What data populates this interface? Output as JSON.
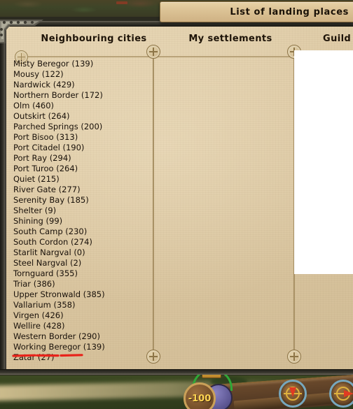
{
  "window": {
    "title": "List of landing places"
  },
  "columns": [
    {
      "id": "neighbouring-cities",
      "label": "Neighbouring cities"
    },
    {
      "id": "my-settlements",
      "label": "My settlements"
    },
    {
      "id": "guild-settlements",
      "label": "Guild s"
    }
  ],
  "cities": [
    {
      "name": "Misty Beregor",
      "value": "(139)",
      "label": "Misty Beregor (139)"
    },
    {
      "name": "Mousy",
      "value": "(122)",
      "label": "Mousy (122)"
    },
    {
      "name": "Nardwick",
      "value": "(429)",
      "label": "Nardwick (429)"
    },
    {
      "name": "Northern Border",
      "value": "(172)",
      "label": "Northern Border (172)"
    },
    {
      "name": "Olm",
      "value": "(460)",
      "label": "Olm (460)"
    },
    {
      "name": "Outskirt",
      "value": "(264)",
      "label": "Outskirt (264)"
    },
    {
      "name": "Parched Springs",
      "value": "(200)",
      "label": "Parched Springs (200)"
    },
    {
      "name": "Port Bisoo",
      "value": "(313)",
      "label": "Port Bisoo (313)"
    },
    {
      "name": "Port Citadel",
      "value": "(190)",
      "label": "Port Citadel (190)"
    },
    {
      "name": "Port Ray",
      "value": "(294)",
      "label": "Port Ray (294)"
    },
    {
      "name": "Port Turoo",
      "value": "(264)",
      "label": "Port Turoo (264)"
    },
    {
      "name": "Quiet",
      "value": "(215)",
      "label": "Quiet (215)"
    },
    {
      "name": "River Gate",
      "value": "(277)",
      "label": "River Gate (277)"
    },
    {
      "name": "Serenity Bay",
      "value": "(185)",
      "label": "Serenity Bay (185)"
    },
    {
      "name": "Shelter",
      "value": "(9)",
      "label": "Shelter (9)"
    },
    {
      "name": "Shining",
      "value": "(99)",
      "label": "Shining (99)"
    },
    {
      "name": "South Camp",
      "value": "(230)",
      "label": "South Camp (230)"
    },
    {
      "name": "South Cordon",
      "value": "(274)",
      "label": "South Cordon (274)"
    },
    {
      "name": "Starlit Nargval",
      "value": "(0)",
      "label": "Starlit Nargval (0)"
    },
    {
      "name": "Steel Nargval",
      "value": "(2)",
      "label": "Steel Nargval (2)"
    },
    {
      "name": "Tornguard",
      "value": "(355)",
      "label": "Tornguard (355)"
    },
    {
      "name": "Triar",
      "value": "(386)",
      "label": "Triar (386)"
    },
    {
      "name": "Upper Stronwald",
      "value": "(385)",
      "label": "Upper Stronwald (385)"
    },
    {
      "name": "Vallarium",
      "value": "(358)",
      "label": "Vallarium (358)"
    },
    {
      "name": "Virgen",
      "value": "(426)",
      "label": "Virgen (426)"
    },
    {
      "name": "Wellire",
      "value": "(428)",
      "label": "Wellire (428)"
    },
    {
      "name": "Western Border",
      "value": "(290)",
      "label": "Western Border (290)"
    },
    {
      "name": "Working Beregor",
      "value": "(139)",
      "label": "Working Beregor (139)"
    },
    {
      "name": "Zatar",
      "value": "(27)",
      "label": "Zatar (27)"
    }
  ],
  "annotation": {
    "target": "Zatar (27)",
    "style": "hand-drawn-underline",
    "color": "#e8231a"
  },
  "hud": {
    "coin_badge": "-100",
    "buttons": [
      {
        "id": "compass-down",
        "icon": "compass-arrow-down-icon"
      },
      {
        "id": "compass-right",
        "icon": "compass-arrow-right-icon"
      }
    ]
  },
  "colors": {
    "parchment": "#ddc9a4",
    "parchment_dark": "#d2bd96",
    "title_bar": "#dcc396",
    "text": "#19110a",
    "rule": "#9b8455",
    "annotation_red": "#e8231a",
    "hud_gold": "#ffd452",
    "white_panel": "#ffffff"
  },
  "icons": {
    "medallion": "quatrefoil-medallion-icon",
    "corner": "ornate-corner-icon"
  }
}
